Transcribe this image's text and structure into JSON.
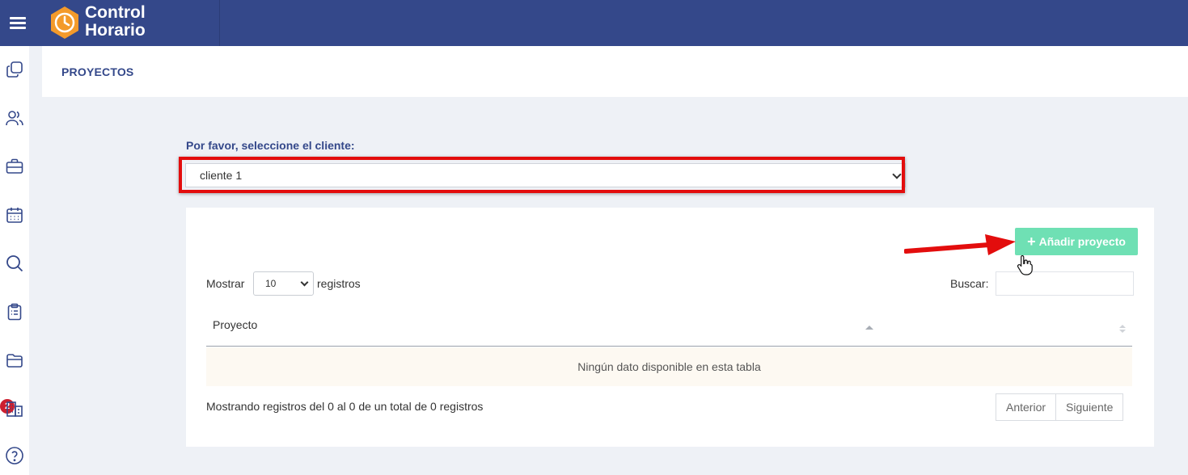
{
  "app": {
    "brand_line1": "Control",
    "brand_line2": "Horario",
    "accent_color": "#34488a",
    "logo_color": "#f39a2b"
  },
  "sidebar": {
    "items": [
      {
        "icon": "copy-icon"
      },
      {
        "icon": "users-icon"
      },
      {
        "icon": "briefcase-icon"
      },
      {
        "icon": "calendar-icon"
      },
      {
        "icon": "search-icon"
      },
      {
        "icon": "clipboard-icon"
      },
      {
        "icon": "folder-icon",
        "badge": "2"
      },
      {
        "icon": "building-icon"
      },
      {
        "icon": "help-icon"
      }
    ]
  },
  "page": {
    "title": "PROYECTOS"
  },
  "client_selector": {
    "label": "Por favor, seleccione el cliente:",
    "selected": "cliente 1"
  },
  "table": {
    "add_button": "Añadir proyecto",
    "show_label": "Mostrar",
    "page_length": "10",
    "records_label": "registros",
    "search_label": "Buscar:",
    "columns": [
      "Proyecto"
    ],
    "empty_text": "Ningún dato disponible en esta tabla",
    "info": "Mostrando registros del 0 al 0 de un total de 0 registros",
    "prev_label": "Anterior",
    "next_label": "Siguiente"
  },
  "annotation": {
    "highlight_color": "#e30d0d",
    "add_button_color": "#6fe0b4"
  }
}
